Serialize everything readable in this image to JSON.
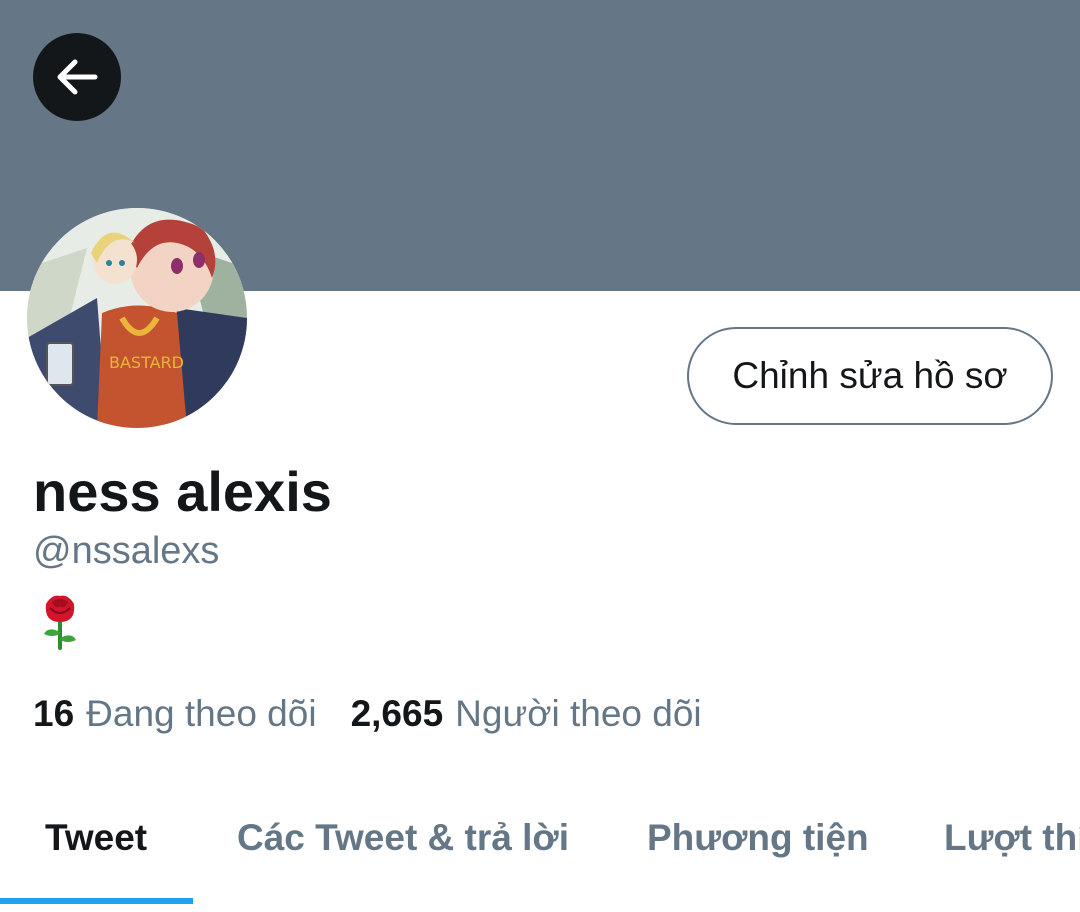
{
  "profile": {
    "display_name": "ness alexis",
    "handle": "@nssalexs",
    "bio_emoji": "rose-emoji",
    "avatar_alt": "avatar"
  },
  "header": {
    "back_icon": "arrow-left-icon",
    "banner_color": "#657786"
  },
  "actions": {
    "edit_profile_label": "Chỉnh sửa hồ sơ"
  },
  "stats": {
    "following_count": "16",
    "following_label": "Đang theo dõi",
    "followers_count": "2,665",
    "followers_label": "Người theo dõi"
  },
  "tabs": [
    {
      "label": "Tweet",
      "active": true
    },
    {
      "label": "Các Tweet & trả lời",
      "active": false
    },
    {
      "label": "Phương tiện",
      "active": false
    },
    {
      "label": "Lượt thích",
      "active": false
    }
  ],
  "colors": {
    "accent": "#1da1f2",
    "text_primary": "#14171a",
    "text_secondary": "#657786"
  }
}
